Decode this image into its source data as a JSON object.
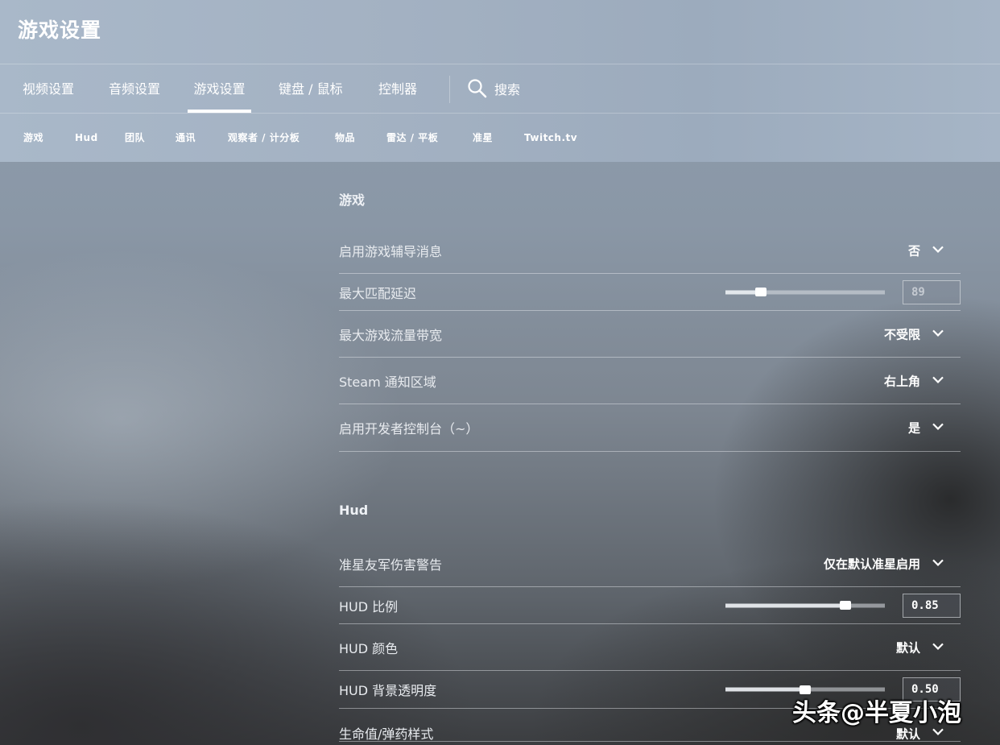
{
  "header": {
    "title": "游戏设置"
  },
  "main_tabs": [
    {
      "label": "视频设置"
    },
    {
      "label": "音频设置"
    },
    {
      "label": "游戏设置",
      "active": true
    },
    {
      "label": "键盘 / 鼠标"
    },
    {
      "label": "控制器"
    }
  ],
  "search": {
    "label": "搜索",
    "icon": "search-icon"
  },
  "sub_tabs": [
    {
      "label": "游戏"
    },
    {
      "label": "Hud"
    },
    {
      "label": "团队"
    },
    {
      "label": "通讯"
    },
    {
      "label": "观察者 / 计分板"
    },
    {
      "label": "物品"
    },
    {
      "label": "雷达 / 平板"
    },
    {
      "label": "准星"
    },
    {
      "label": "Twitch.tv"
    }
  ],
  "sections": {
    "game": {
      "title": "游戏",
      "rows": {
        "tutor_messages": {
          "label": "启用游戏辅导消息",
          "value": "否"
        },
        "max_ping": {
          "label": "最大匹配延迟",
          "value": "89",
          "level": 0.22
        },
        "max_bandwidth": {
          "label": "最大游戏流量带宽",
          "value": "不受限"
        },
        "steam_notify": {
          "label": "Steam 通知区域",
          "value": "右上角"
        },
        "dev_console": {
          "label": "启用开发者控制台（~）",
          "value": "是"
        }
      }
    },
    "hud": {
      "title": "Hud",
      "rows": {
        "ff_warning": {
          "label": "准星友军伤害警告",
          "value": "仅在默认准星启用"
        },
        "hud_scale": {
          "label": "HUD 比例",
          "value": "0.85",
          "level": 0.75
        },
        "hud_color": {
          "label": "HUD 颜色",
          "value": "默认"
        },
        "hud_alpha": {
          "label": "HUD 背景透明度",
          "value": "0.50",
          "level": 0.5
        },
        "health_ammo": {
          "label": "生命值/弹药样式",
          "value": "默认"
        }
      }
    }
  },
  "watermark": {
    "text": "头条@半夏小泡"
  }
}
